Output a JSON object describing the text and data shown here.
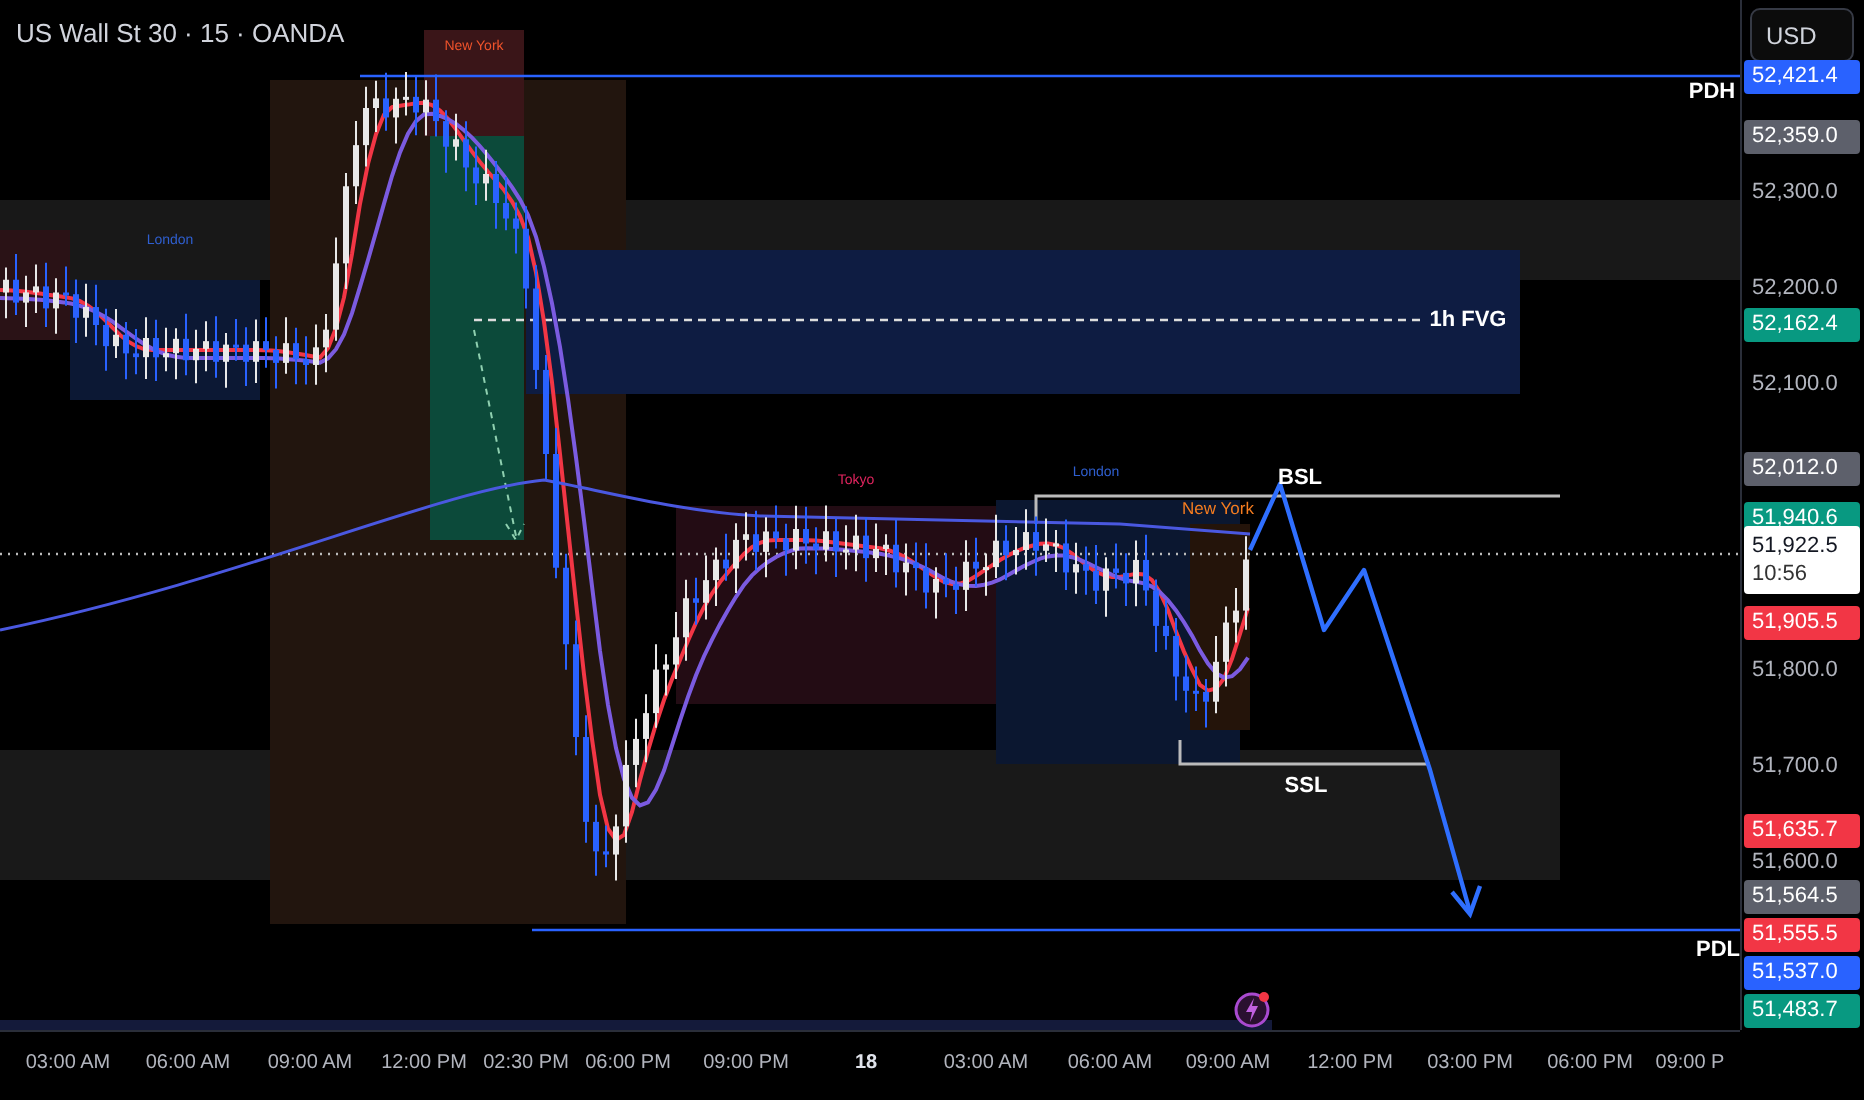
{
  "header": {
    "title": "US Wall St 30 · 15 · OANDA",
    "currency_button": "USD"
  },
  "chart_labels": [
    {
      "kind": "session",
      "text": "New York",
      "color": "#f0532b"
    },
    {
      "kind": "session",
      "text": "London",
      "color": "#2f5fd0"
    },
    {
      "kind": "session",
      "text": "Tokyo",
      "color": "#e0245e"
    },
    {
      "kind": "session",
      "text": "London",
      "color": "#2f5fd0"
    },
    {
      "kind": "session",
      "text": "New York",
      "color": "#f57c1f"
    },
    {
      "kind": "level",
      "text": "BSL"
    },
    {
      "kind": "level",
      "text": "SSL"
    },
    {
      "kind": "level",
      "text": "1h FVG"
    },
    {
      "kind": "level",
      "text": "PDH"
    },
    {
      "kind": "level",
      "text": "PDL"
    }
  ],
  "price_labels": [
    {
      "kind": "badge",
      "text": "52,421.4",
      "color": "#2962ff"
    },
    {
      "kind": "badge",
      "text": "52,359.0",
      "color": "#5d606b"
    },
    {
      "kind": "tick",
      "text": "52,300.0"
    },
    {
      "kind": "tick",
      "text": "52,200.0"
    },
    {
      "kind": "badge",
      "text": "52,162.4",
      "color": "#089981"
    },
    {
      "kind": "tick",
      "text": "52,100.0"
    },
    {
      "kind": "badge",
      "text": "52,012.0",
      "color": "#5d606b"
    },
    {
      "kind": "badge",
      "text": "51,940.6",
      "color": "#089981"
    },
    {
      "kind": "current",
      "text": "51,922.5",
      "countdown": "10:56"
    },
    {
      "kind": "badge",
      "text": "51,905.5",
      "color": "#f23645"
    },
    {
      "kind": "tick",
      "text": "51,800.0"
    },
    {
      "kind": "tick",
      "text": "51,700.0"
    },
    {
      "kind": "badge",
      "text": "51,635.7",
      "color": "#f23645"
    },
    {
      "kind": "tick",
      "text": "51,600.0"
    },
    {
      "kind": "badge",
      "text": "51,564.5",
      "color": "#5d606b"
    },
    {
      "kind": "badge",
      "text": "51,555.5",
      "color": "#f23645"
    },
    {
      "kind": "badge",
      "text": "51,537.0",
      "color": "#2962ff"
    },
    {
      "kind": "badge",
      "text": "51,483.7",
      "color": "#089981"
    }
  ],
  "time_labels": [
    {
      "kind": "time",
      "text": "03:00 AM"
    },
    {
      "kind": "time",
      "text": "06:00 AM"
    },
    {
      "kind": "time",
      "text": "09:00 AM"
    },
    {
      "kind": "time",
      "text": "12:00 PM"
    },
    {
      "kind": "time",
      "text": "02:30 PM"
    },
    {
      "kind": "time",
      "text": "06:00 PM"
    },
    {
      "kind": "time",
      "text": "09:00 PM"
    },
    {
      "kind": "day",
      "text": "18"
    },
    {
      "kind": "time",
      "text": "03:00 AM"
    },
    {
      "kind": "time",
      "text": "06:00 AM"
    },
    {
      "kind": "time",
      "text": "09:00 AM"
    },
    {
      "kind": "time",
      "text": "12:00 PM"
    },
    {
      "kind": "time",
      "text": "03:00 PM"
    },
    {
      "kind": "time",
      "text": "06:00 PM"
    },
    {
      "kind": "time",
      "text": "09:00 P"
    }
  ]
}
